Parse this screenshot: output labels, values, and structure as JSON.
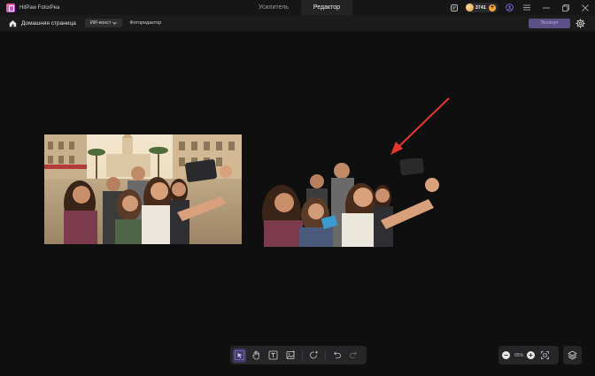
{
  "titlebar": {
    "app_title": "HitPaw FotorPea",
    "tabs": [
      {
        "label": "Усилитель",
        "active": false
      },
      {
        "label": "Редактор",
        "active": true
      }
    ],
    "coins": "3741"
  },
  "toolbar": {
    "home_label": "Домашняя страница",
    "ai_chip": "ИИ-конст",
    "editor_label": "Фоторедактор",
    "export_label": "Экспорт"
  },
  "zoom": {
    "value": "65%"
  },
  "colors": {
    "accent": "#6c5ce7",
    "arrow": "#e5382f",
    "coin": "#f5a93a"
  }
}
